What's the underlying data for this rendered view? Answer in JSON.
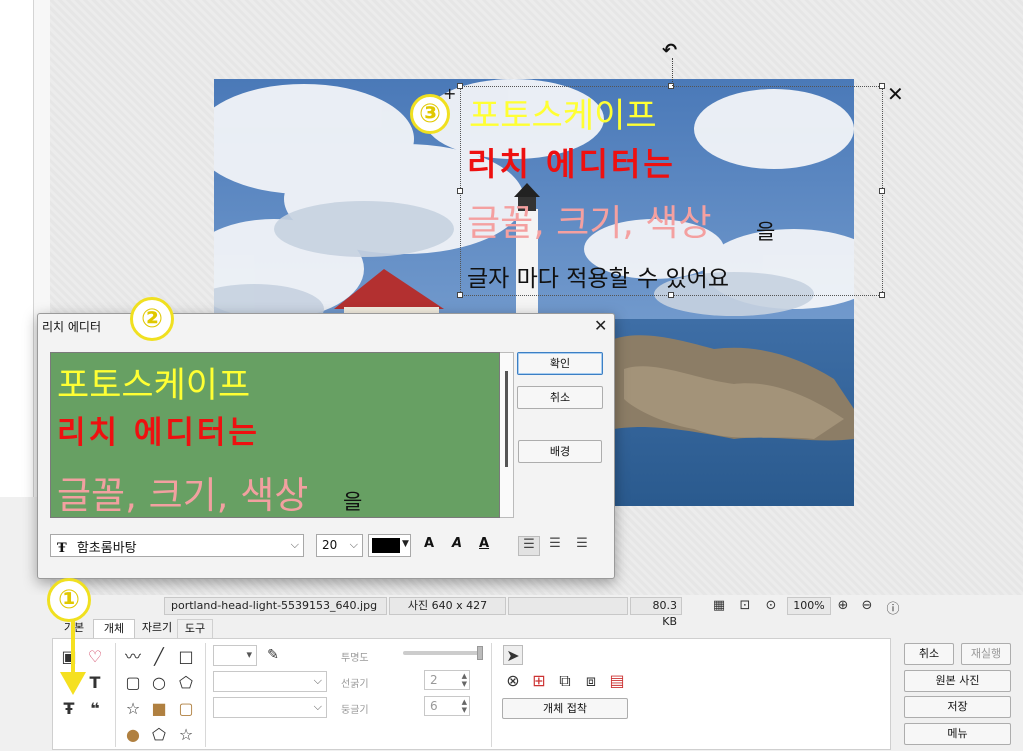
{
  "overlay": {
    "line1": "포토스케이프",
    "line2": "리치 에디터는",
    "line3": "글꼴, 크기, 색상",
    "line3_suffix": "을",
    "line4": "글자 마다 적용할 수 있어요"
  },
  "badges": {
    "one": "①",
    "two": "②",
    "three": "③"
  },
  "dialog": {
    "title": "리치 에디터",
    "close": "✕",
    "editor": {
      "line1": "포토스케이프",
      "line2": "리치 에디터는",
      "line3": "글꼴, 크기, 색상",
      "line3_suffix": "을"
    },
    "ok": "확인",
    "cancel": "취소",
    "background": "배경",
    "font_icon": "Ŧ",
    "font": "함초롬바탕",
    "size": "20",
    "format": {
      "bold": "A",
      "italic": "A",
      "underline": "A"
    }
  },
  "status": {
    "filename": "portland-head-light-5539153_640.jpg",
    "dimensions": "사진 640 x 427",
    "filesize": "80.3 KB",
    "zoom": "100%"
  },
  "tabs": [
    "기본",
    "개체",
    "자르기",
    "도구"
  ],
  "toolpanel": {
    "opacity_label": "투명도",
    "line_width_label": "선굵기",
    "line_width": "2",
    "round_label": "둥글기",
    "round": "6",
    "merge": "개체 접착"
  },
  "right_buttons": {
    "cancel": "취소",
    "redo": "재실행",
    "original": "원본 사진",
    "save": "저장",
    "menu": "메뉴"
  },
  "colors": {
    "editor_bg": "#67a063",
    "yellow": "#ffff33",
    "red": "#ee1010",
    "pink": "#f4a0a0",
    "accent": "#3c7fc4"
  }
}
